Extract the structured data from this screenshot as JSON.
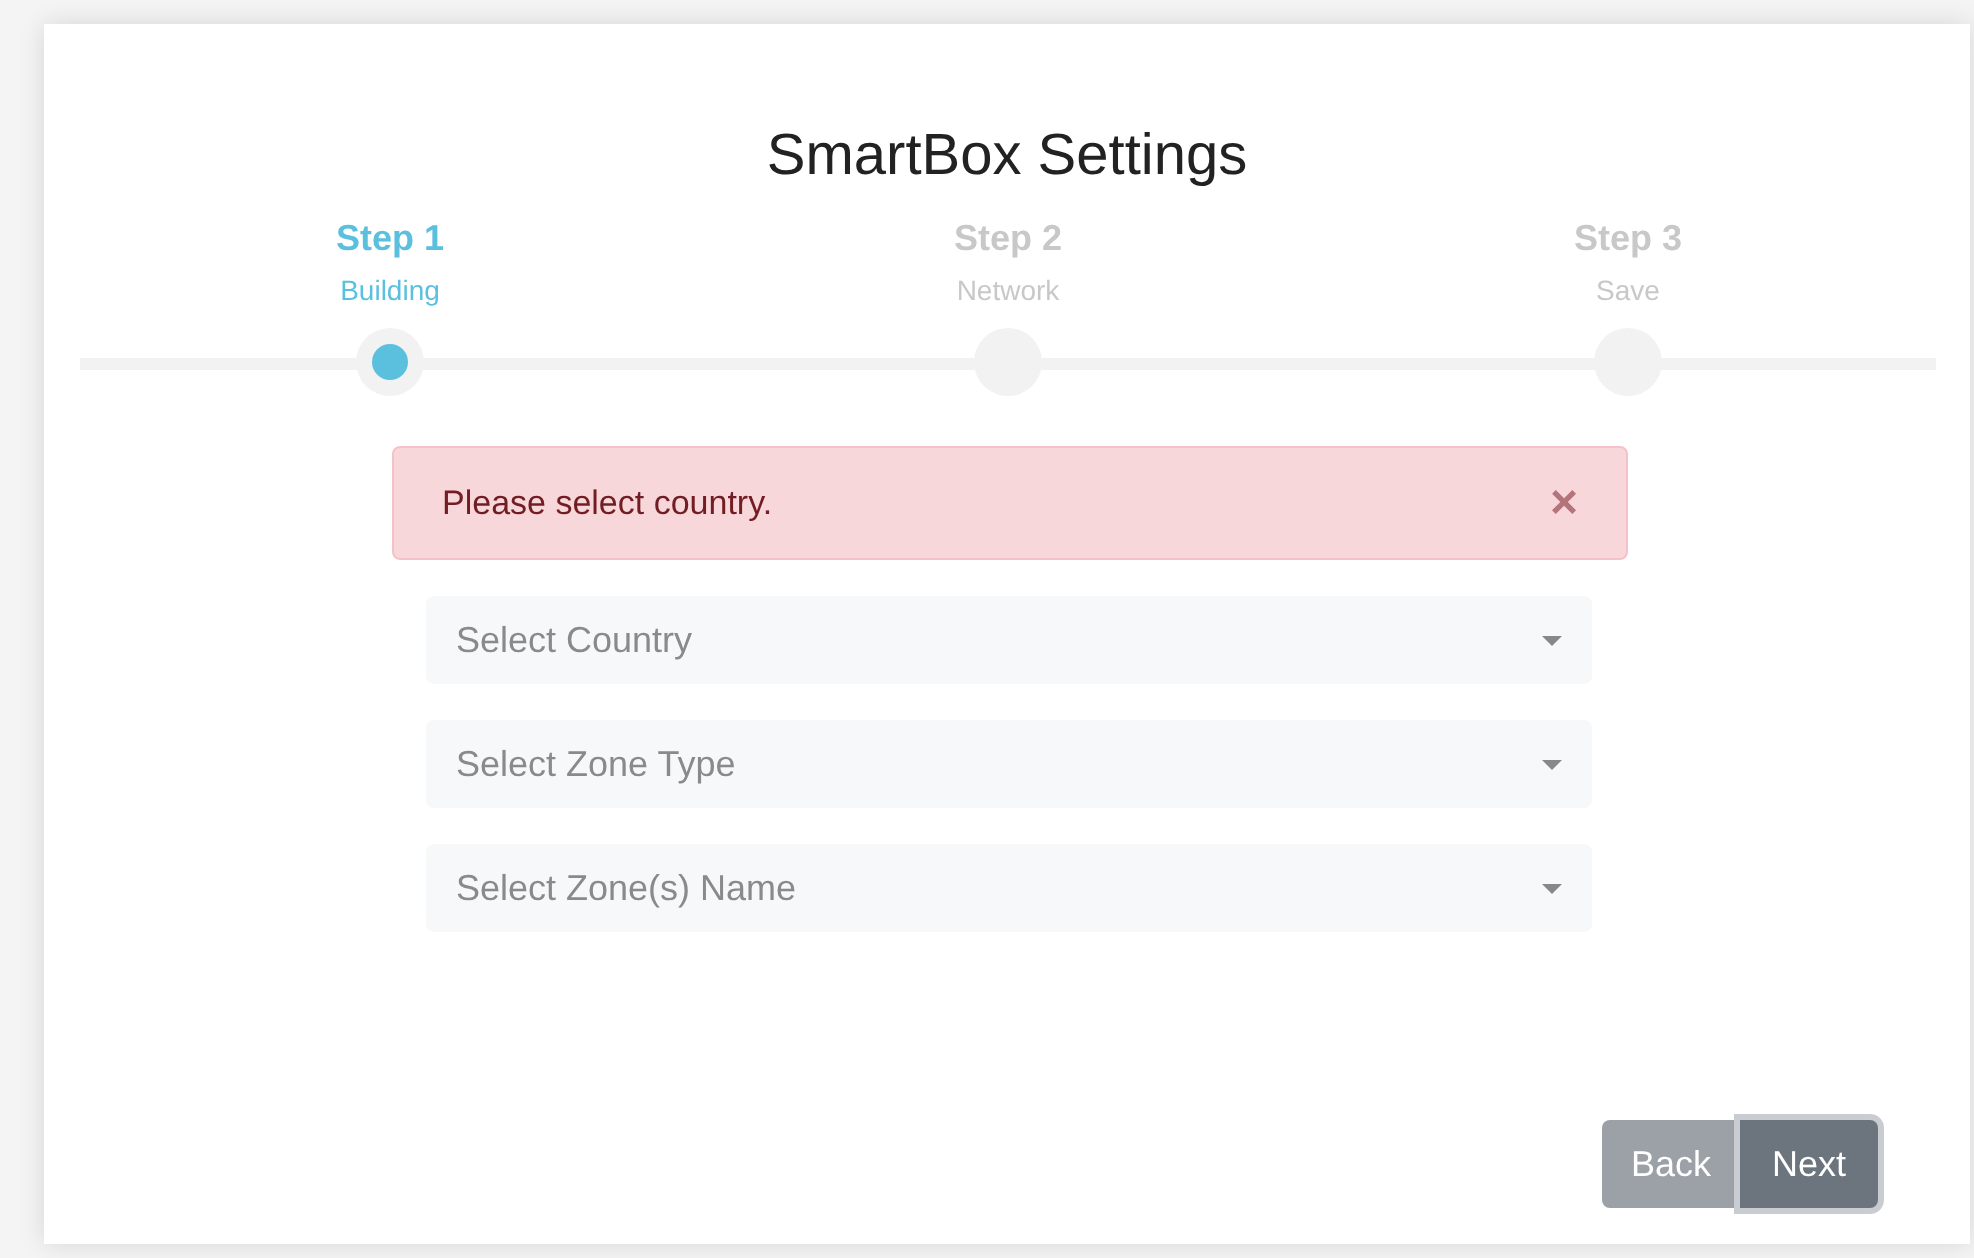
{
  "title": "SmartBox Settings",
  "steps": [
    {
      "label": "Step 1",
      "caption": "Building",
      "selected": true
    },
    {
      "label": "Step 2",
      "caption": "Network",
      "selected": false
    },
    {
      "label": "Step 3",
      "caption": "Save",
      "selected": false
    }
  ],
  "alert": {
    "message": "Please select country.",
    "close": "×"
  },
  "selects": [
    {
      "placeholder": "Select Country"
    },
    {
      "placeholder": "Select Zone Type"
    },
    {
      "placeholder": "Select Zone(s) Name"
    }
  ],
  "buttons": [
    {
      "label": "Back",
      "disabled": true,
      "focused": false
    },
    {
      "label": "Next",
      "disabled": false,
      "focused": true
    }
  ]
}
